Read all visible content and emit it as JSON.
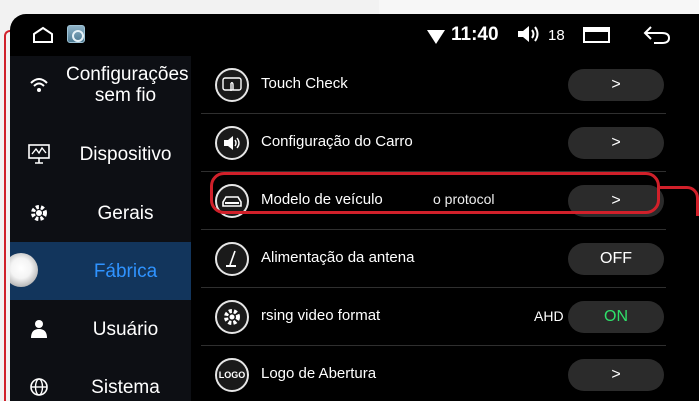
{
  "statusbar": {
    "time": "11:40",
    "volume_icon": "speaker-icon",
    "volume": "18"
  },
  "sidebar": {
    "items": [
      {
        "label": "Configurações sem fio",
        "icon": "wifi-icon"
      },
      {
        "label": "Dispositivo",
        "icon": "monitor-icon"
      },
      {
        "label": "Gerais",
        "icon": "gear-icon"
      },
      {
        "label": "Fábrica",
        "icon": "knob-icon",
        "active": true
      },
      {
        "label": "Usuário",
        "icon": "user-icon"
      },
      {
        "label": "Sistema",
        "icon": "globe-icon"
      }
    ]
  },
  "list": {
    "rows": [
      {
        "label": "Touch Check",
        "icon": "touch-icon",
        "control": ">"
      },
      {
        "label": "Configuração do Carro",
        "icon": "speaker-icon",
        "control": ">"
      },
      {
        "label": "Modelo de veículo",
        "extra": "o protocol",
        "icon": "car-icon",
        "control": ">"
      },
      {
        "label": "Alimentação da antena",
        "icon": "antenna-icon",
        "control": "OFF"
      },
      {
        "label": "rsing video format",
        "icon": "settings-icon",
        "option": "AHD",
        "control": "ON"
      },
      {
        "label": "Logo de Abertura",
        "icon_text": "LOGO",
        "icon": "logo-icon",
        "control": ">"
      }
    ]
  },
  "colors": {
    "highlight": "#d0202a",
    "active_bg": "#12355c",
    "active_text": "#2f93ff",
    "on_text": "#2fe06a"
  }
}
